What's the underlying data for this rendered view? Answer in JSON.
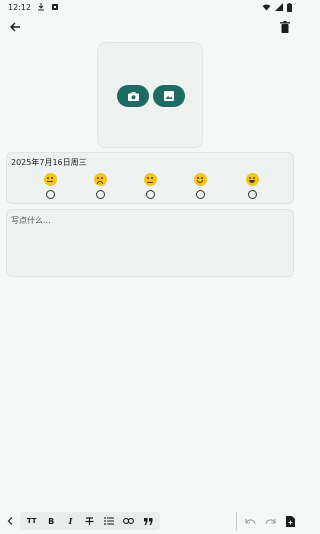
{
  "status_bar": {
    "time": "12:12",
    "icons": [
      "download-icon",
      "notification-icon",
      "wifi-icon",
      "signal-icon",
      "battery-icon"
    ]
  },
  "app_bar": {
    "back_icon": "arrow-back-icon",
    "delete_icon": "trash-icon"
  },
  "image_picker": {
    "buttons": [
      "camera-icon",
      "gallery-icon"
    ],
    "accent_color": "#1f6a62"
  },
  "mood": {
    "date": "2025年7月16日周三",
    "options": [
      {
        "icon": "very-sad-face-icon"
      },
      {
        "icon": "sad-face-icon"
      },
      {
        "icon": "neutral-face-icon"
      },
      {
        "icon": "slight-smile-face-icon"
      },
      {
        "icon": "happy-face-icon"
      }
    ]
  },
  "editor": {
    "placeholder": "写点什么..."
  },
  "toolbar": {
    "items": [
      "text-size-icon",
      "bold-icon",
      "italic-icon",
      "strikethrough-icon",
      "bullet-list-icon",
      "link-icon",
      "quote-icon"
    ],
    "bold_label": "B",
    "italic_label": "I",
    "text_size_label": "TT",
    "right": [
      "undo-icon",
      "redo-icon",
      "add-page-icon"
    ]
  }
}
